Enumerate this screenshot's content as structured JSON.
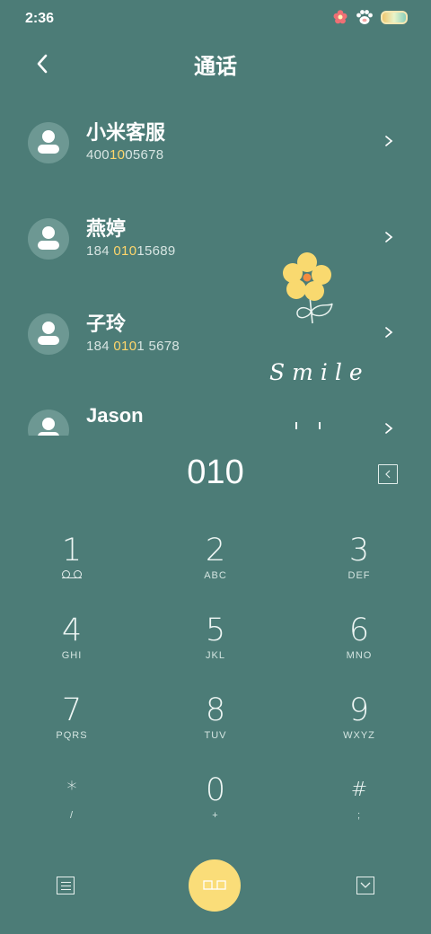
{
  "status_bar": {
    "time": "2:36",
    "icons": [
      "flower-icon",
      "paw-icon",
      "battery-icon"
    ]
  },
  "header": {
    "title": "通话",
    "back_icon": "chevron-left-icon"
  },
  "contacts": [
    {
      "name": "小米客服",
      "number_parts": [
        "400",
        "10",
        "05678"
      ]
    },
    {
      "name": "燕婷",
      "number_parts": [
        "184 ",
        "010",
        "15689"
      ]
    },
    {
      "name": "子玲",
      "number_parts": [
        "184 ",
        "010",
        "1 5678"
      ]
    },
    {
      "name": "Jason",
      "number_parts": [
        "",
        "",
        ""
      ]
    }
  ],
  "decor": {
    "text": "Smile",
    "flower_colors": [
      "#f9d96f",
      "#f48b40"
    ]
  },
  "dialer": {
    "number": "010"
  },
  "keypad": [
    {
      "digit": "1",
      "letters": ""
    },
    {
      "digit": "2",
      "letters": "ABC"
    },
    {
      "digit": "3",
      "letters": "DEF"
    },
    {
      "digit": "4",
      "letters": "GHI"
    },
    {
      "digit": "5",
      "letters": "JKL"
    },
    {
      "digit": "6",
      "letters": "MNO"
    },
    {
      "digit": "7",
      "letters": "PQRS"
    },
    {
      "digit": "8",
      "letters": "TUV"
    },
    {
      "digit": "9",
      "letters": "WXYZ"
    },
    {
      "digit": "*",
      "letters": "/"
    },
    {
      "digit": "0",
      "letters": "+"
    },
    {
      "digit": "#",
      "letters": ";"
    }
  ],
  "bottom_bar": {
    "icons": [
      "menu-icon",
      "dial-call-icon",
      "collapse-icon"
    ]
  },
  "colors": {
    "background": "#4c7c77",
    "accent": "#fadd79",
    "highlight": "#ffd66b"
  }
}
